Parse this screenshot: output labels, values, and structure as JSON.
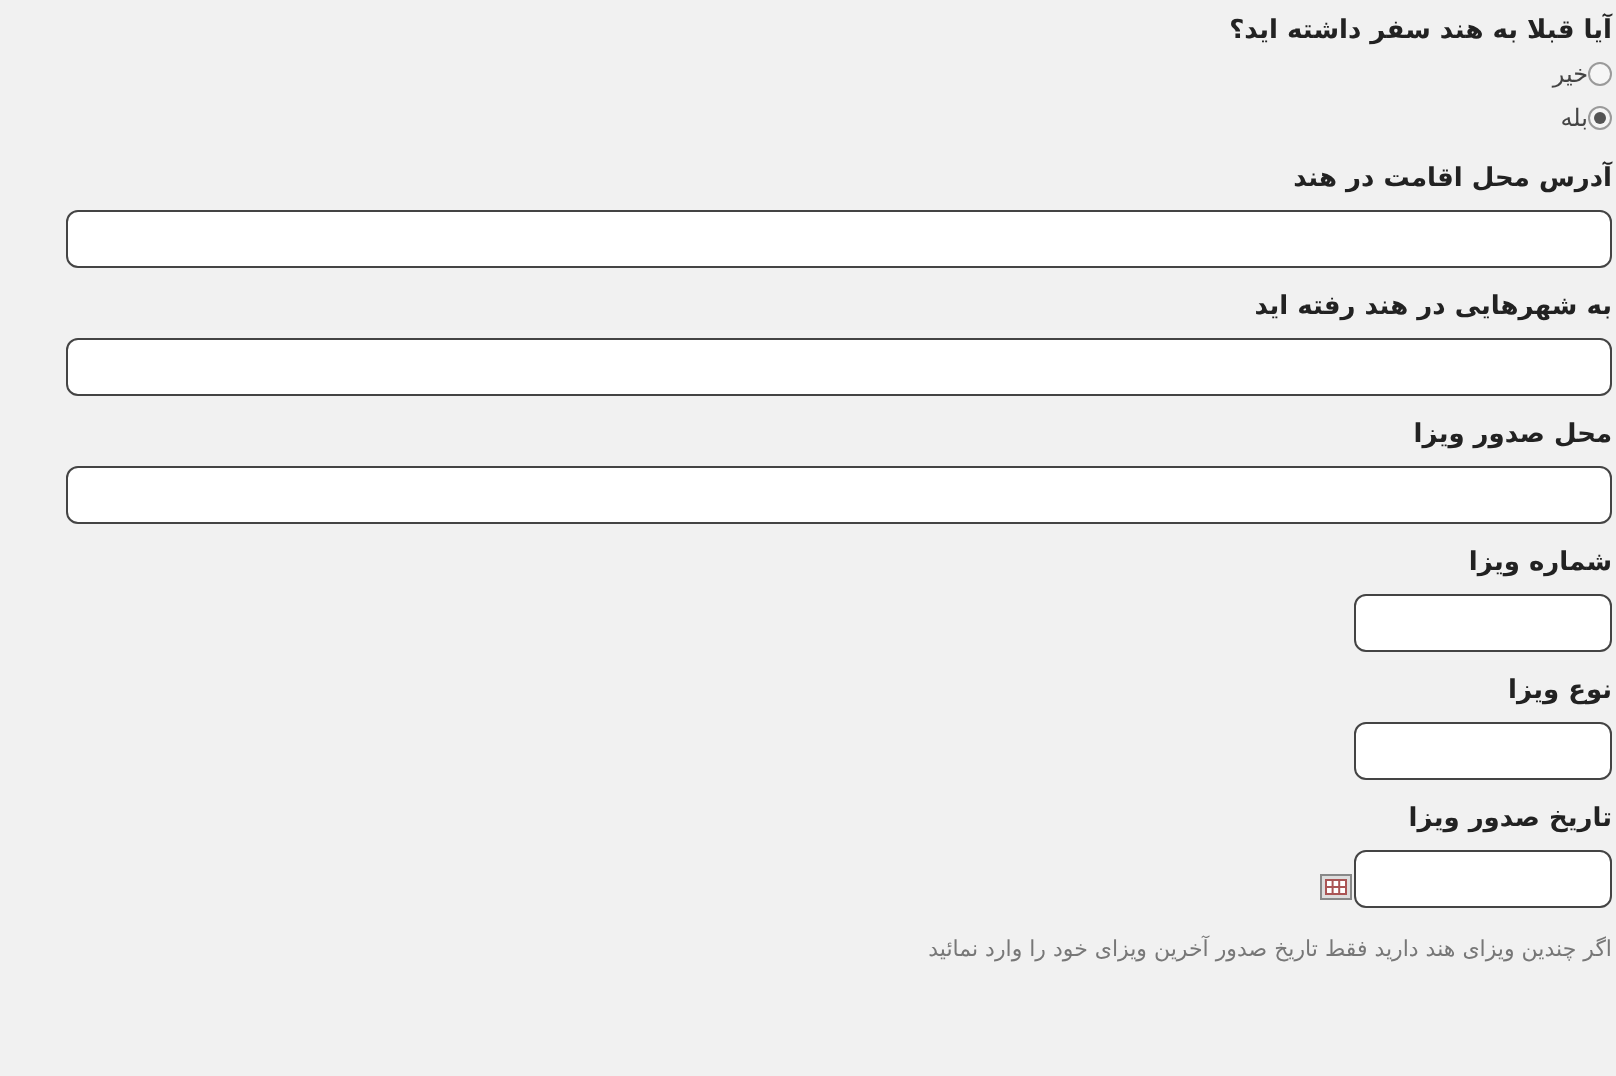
{
  "question": {
    "label": "آیا قبلا به هند سفر داشته اید؟",
    "options": [
      {
        "label": "خیر",
        "selected": false
      },
      {
        "label": "بله",
        "selected": true
      }
    ]
  },
  "fields": [
    {
      "label": "آدرس محل اقامت در هند",
      "kind": "wide"
    },
    {
      "label": "به شهرهایی در هند رفته اید",
      "kind": "wide"
    },
    {
      "label": "محل صدور ویزا",
      "kind": "wide"
    },
    {
      "label": "شماره ویزا",
      "kind": "short"
    },
    {
      "label": "نوع ویزا",
      "kind": "short"
    },
    {
      "label": "تاریخ صدور ویزا",
      "kind": "date"
    }
  ],
  "hint": "اگر چندین ویزای هند دارید فقط تاریخ صدور آخرین ویزای خود را وارد نمائید"
}
